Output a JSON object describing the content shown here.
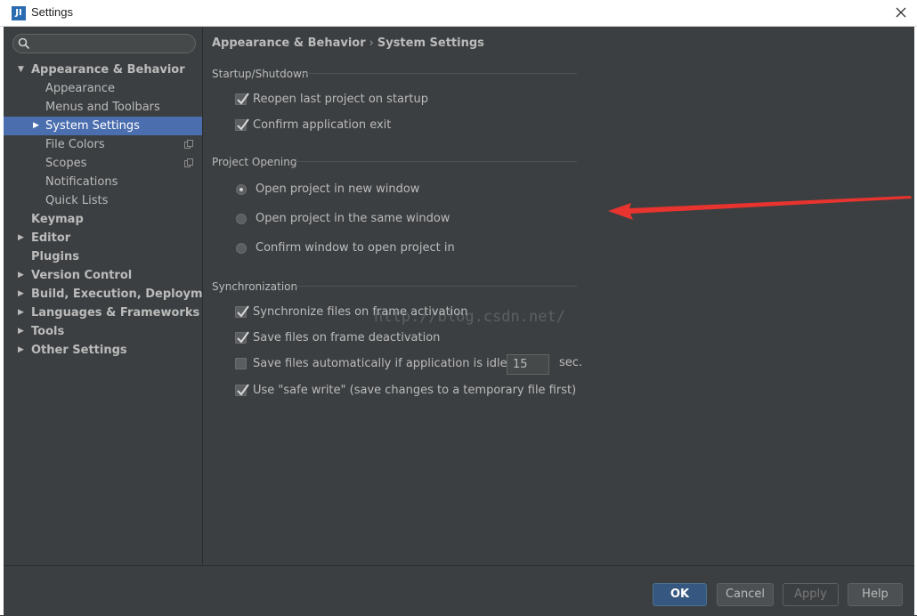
{
  "window": {
    "title": "Settings",
    "app_icon_text": "JI"
  },
  "sidebar": {
    "search_placeholder": "",
    "items": [
      {
        "label": "Appearance & Behavior",
        "bold": true,
        "arrow": "expanded"
      },
      {
        "label": "Appearance"
      },
      {
        "label": "Menus and Toolbars"
      },
      {
        "label": "System Settings",
        "selected": true,
        "arrow": "collapsed"
      },
      {
        "label": "File Colors",
        "copy_icon": true
      },
      {
        "label": "Scopes",
        "copy_icon": true
      },
      {
        "label": "Notifications"
      },
      {
        "label": "Quick Lists"
      },
      {
        "label": "Keymap",
        "bold": true
      },
      {
        "label": "Editor",
        "bold": true,
        "arrow": "collapsed"
      },
      {
        "label": "Plugins",
        "bold": true
      },
      {
        "label": "Version Control",
        "bold": true,
        "arrow": "collapsed"
      },
      {
        "label": "Build, Execution, Deployment",
        "bold": true,
        "arrow": "collapsed"
      },
      {
        "label": "Languages & Frameworks",
        "bold": true,
        "arrow": "collapsed"
      },
      {
        "label": "Tools",
        "bold": true,
        "arrow": "collapsed"
      },
      {
        "label": "Other Settings",
        "bold": true,
        "arrow": "collapsed"
      }
    ]
  },
  "breadcrumb": {
    "parent": "Appearance & Behavior",
    "separator": "›",
    "current": "System Settings"
  },
  "startup": {
    "title": "Startup/Shutdown",
    "reopen_label": "Reopen last project on startup",
    "reopen_checked": true,
    "confirm_exit_label": "Confirm application exit",
    "confirm_exit_checked": true
  },
  "project_opening": {
    "title": "Project Opening",
    "options": [
      {
        "label": "Open project in new window",
        "selected": true
      },
      {
        "label": "Open project in the same window",
        "selected": false
      },
      {
        "label": "Confirm window to open project in",
        "selected": false
      }
    ]
  },
  "sync": {
    "title": "Synchronization",
    "sync_on_activation_label": "Synchronize files on frame activation",
    "sync_on_activation_checked": true,
    "save_on_deactivation_label": "Save files on frame deactivation",
    "save_on_deactivation_checked": true,
    "save_idle_label": "Save files automatically if application is idle for",
    "save_idle_checked": false,
    "idle_value": "15",
    "idle_unit": "sec.",
    "safe_write_label": "Use \"safe write\" (save changes to a temporary file first)",
    "safe_write_checked": true
  },
  "watermark": "http://blog.csdn.net/",
  "buttons": {
    "ok": "OK",
    "cancel": "Cancel",
    "apply": "Apply",
    "help": "Help"
  },
  "colors": {
    "background": "#3c3f41",
    "selection": "#4b6eaf",
    "primary_button": "#365880",
    "annotation_arrow": "#e8332f"
  }
}
